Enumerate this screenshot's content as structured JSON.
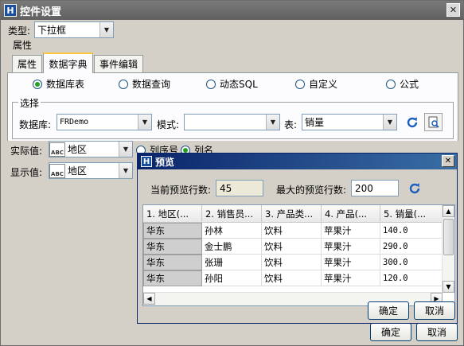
{
  "window": {
    "title": "控件设置"
  },
  "type_row": {
    "label": "类型:",
    "value": "下拉框"
  },
  "attributes_group": {
    "label": "属性"
  },
  "tabs": [
    {
      "label": "属性"
    },
    {
      "label": "数据字典"
    },
    {
      "label": "事件编辑"
    }
  ],
  "source_options": [
    {
      "label": "数据库表",
      "selected": true
    },
    {
      "label": "数据查询",
      "selected": false
    },
    {
      "label": "动态SQL",
      "selected": false
    },
    {
      "label": "自定义",
      "selected": false
    },
    {
      "label": "公式",
      "selected": false
    }
  ],
  "select_group": {
    "label": "选择",
    "database_label": "数据库:",
    "database_value": "FRDemo",
    "schema_label": "模式:",
    "schema_value": "",
    "table_label": "表:",
    "table_value": "销量"
  },
  "actual_value": {
    "label": "实际值:",
    "icon_text": "ABC",
    "value": "地区"
  },
  "display_value": {
    "label": "显示值:",
    "icon_text": "ABC",
    "value": "地区"
  },
  "column_mode": [
    {
      "label": "列序号",
      "selected": false
    },
    {
      "label": "列名",
      "selected": true
    }
  ],
  "main_buttons": {
    "ok": "确定",
    "cancel": "取消"
  },
  "preview": {
    "title": "预览",
    "current_rows_label": "当前预览行数:",
    "current_rows_value": "45",
    "max_rows_label": "最大的预览行数:",
    "max_rows_value": "200",
    "columns": [
      "1. 地区(...",
      "2. 销售员...",
      "3. 产品类...",
      "4. 产品(...",
      "5. 销量(..."
    ],
    "rows": [
      [
        "华东",
        "孙林",
        "饮料",
        "苹果汁",
        "140.0"
      ],
      [
        "华东",
        "金士鹏",
        "饮料",
        "苹果汁",
        "290.0"
      ],
      [
        "华东",
        "张珊",
        "饮料",
        "苹果汁",
        "300.0"
      ],
      [
        "华东",
        "孙阳",
        "饮料",
        "苹果汁",
        "120.0"
      ]
    ],
    "ok": "确定",
    "cancel": "取消"
  },
  "colors": {
    "title_active": "#0a246a",
    "tab_highlight": "#ffc83c",
    "radio_dot": "#21a121"
  }
}
